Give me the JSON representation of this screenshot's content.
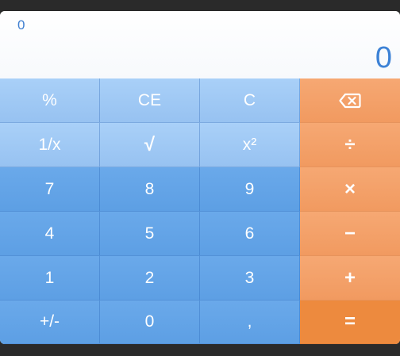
{
  "display": {
    "expression": "0",
    "result": "0"
  },
  "keys": {
    "percent": "%",
    "clear_entry": "CE",
    "clear": "C",
    "reciprocal": "1/x",
    "sqrt": "√",
    "square": "x²",
    "divide": "÷",
    "seven": "7",
    "eight": "8",
    "nine": "9",
    "multiply": "×",
    "four": "4",
    "five": "5",
    "six": "6",
    "minus": "−",
    "one": "1",
    "two": "2",
    "three": "3",
    "plus": "+",
    "negate": "+/-",
    "zero": "0",
    "decimal": ",",
    "equals": "="
  },
  "icons": {
    "backspace": "backspace-icon"
  },
  "colors": {
    "function_key": "#a9d0f8",
    "number_key": "#6aa9ea",
    "operator_key": "#f6a873",
    "equals_key": "#ed8a3e",
    "display_text": "#3d82d6"
  }
}
